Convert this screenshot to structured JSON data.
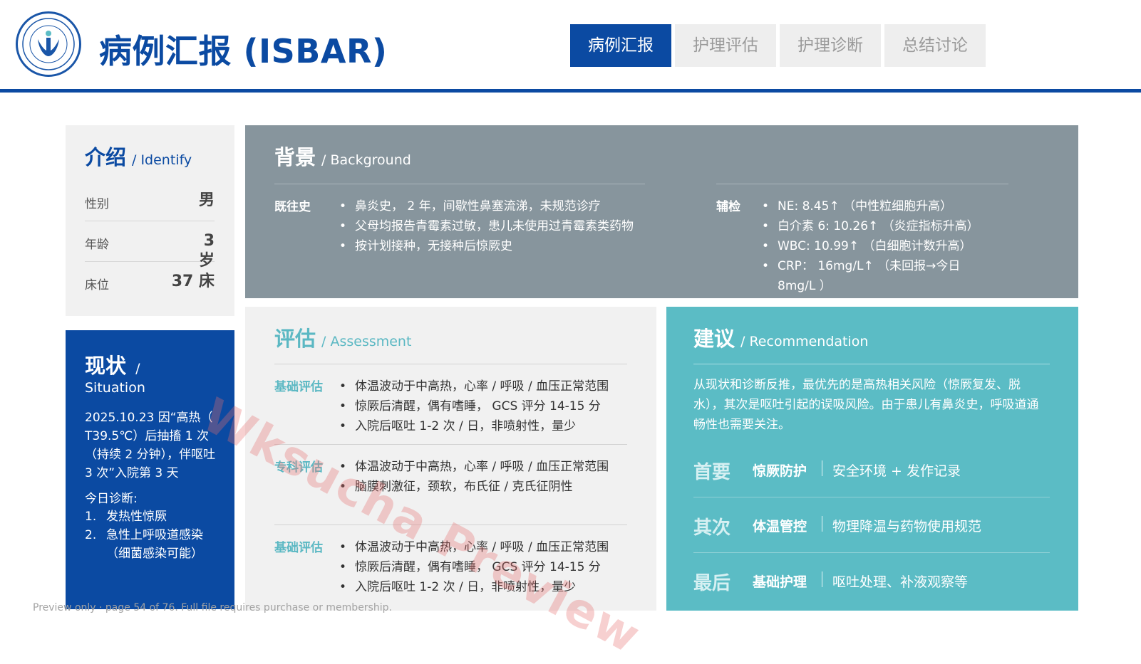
{
  "header": {
    "title": "病例汇报 (ISBAR)",
    "tabs": [
      {
        "label": "病例汇报",
        "active": true
      },
      {
        "label": "护理评估",
        "active": false
      },
      {
        "label": "护理诊断",
        "active": false
      },
      {
        "label": "总结讨论",
        "active": false
      }
    ]
  },
  "identify": {
    "title": "介绍",
    "title_en": "/ Identify",
    "rows": [
      {
        "label": "性别",
        "value": "男"
      },
      {
        "label": "年龄",
        "value": "3 岁"
      },
      {
        "label": "床位",
        "value": "37 床"
      }
    ]
  },
  "situation": {
    "title": "现状",
    "title_sep": "/",
    "title_en": "Situation",
    "text": "2025.10.23 因“高热（ T39.5℃）后抽搐 1 次（持续 2 分钟），伴呕吐 3 次”入院第 3 天",
    "diagnosis_title": "今日诊断:",
    "diagnoses": [
      {
        "num": "1.",
        "text": "发热性惊厥"
      },
      {
        "num": "2.",
        "text": "急性上呼吸道感染（细菌感染可能）"
      }
    ]
  },
  "background": {
    "title": "背景",
    "title_en": "/ Background",
    "history_label": "既往史",
    "history": [
      "鼻炎史， 2 年，间歇性鼻塞流涕，未规范诊疗",
      " 父母均报告青霉素过敏，患儿未使用过青霉素类药物",
      "按计划接种，无接种后惊厥史"
    ],
    "tests_label": "辅检",
    "tests": [
      "NE: 8.45↑ （中性粒细胞升高）",
      "白介素 6: 10.26↑ （炎症指标升高）",
      "WBC: 10.99↑ （白细胞计数升高）",
      "CRP： 16mg/L↑ （未回报→今日 8mg/L ）"
    ]
  },
  "assessment": {
    "title": "评估",
    "title_en": "/ Assessment",
    "sections": [
      {
        "label": "基础评估",
        "items": [
          "体温波动于中高热，心率 / 呼吸 / 血压正常范围",
          "惊厥后清醒，偶有嗜睡， GCS 评分 14-15 分",
          "入院后呕吐 1-2 次 / 日，非喷射性，量少"
        ]
      },
      {
        "label": "专科评估",
        "items": [
          "体温波动于中高热，心率 / 呼吸 / 血压正常范围",
          "脑膜刺激征，颈软，布氏征 / 克氏征阴性"
        ]
      },
      {
        "label": "基础评估",
        "items": [
          "体温波动于中高热，心率 / 呼吸 / 血压正常范围",
          "惊厥后清醒，偶有嗜睡， GCS 评分 14-15 分",
          "入院后呕吐 1-2 次 / 日，非喷射性，量少"
        ]
      }
    ]
  },
  "recommendation": {
    "title": "建议",
    "title_en": "/ Recommendation",
    "text": "从现状和诊断反推，最优先的是高热相关风险（惊厥复发、脱水），其次是呕吐引起的误吸风险。由于患儿有鼻炎史，呼吸道通畅性也需要关注。",
    "rows": [
      {
        "priority": "首要",
        "name": "惊厥防护",
        "desc": "安全环境 + 发作记录"
      },
      {
        "priority": "其次",
        "name": "体温管控",
        "desc": "物理降温与药物使用规范"
      },
      {
        "priority": "最后",
        "name": "基础护理",
        "desc": "呕吐处理、补液观察等"
      }
    ]
  },
  "watermark": "Wksucha Preview",
  "footer": "Preview only · page 54 of 76. Full file requires purchase or membership.",
  "colors": {
    "primary": "#0b4aa2",
    "gray_card": "#87959d",
    "teal": "#5bbcc5",
    "watermark": "#e76e6e"
  }
}
